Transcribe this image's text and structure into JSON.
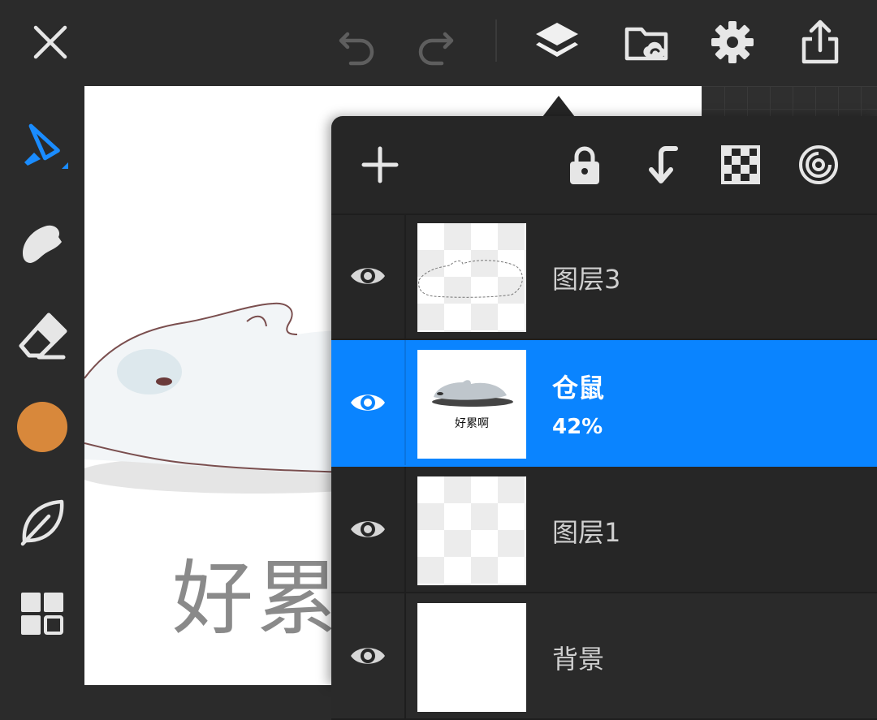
{
  "toolbar": {
    "close": "close-icon",
    "undo": "undo-icon",
    "redo": "redo-icon",
    "layers": "layers-icon",
    "gallery": "gallery-cloud-icon",
    "settings": "gear-icon",
    "share": "share-icon"
  },
  "tools": {
    "brush": "brush-icon",
    "smudge": "smudge-icon",
    "eraser": "eraser-icon",
    "color": "#d8883b",
    "leaf": "leaf-icon",
    "more": "grid-icon"
  },
  "canvas": {
    "text": "好累"
  },
  "layers_panel": {
    "toolbar": [
      "add-icon",
      "lock-icon",
      "merge-down-icon",
      "transparency-icon",
      "layer-effect-icon"
    ],
    "accent": "#0a84ff",
    "layers": [
      {
        "name": "图层3",
        "opacity": "",
        "selected": false,
        "thumb": "sketch"
      },
      {
        "name": "仓鼠",
        "opacity": "42%",
        "selected": true,
        "thumb": "hamster",
        "thumb_caption": "好累啊"
      },
      {
        "name": "图层1",
        "opacity": "",
        "selected": false,
        "thumb": "empty"
      },
      {
        "name": "背景",
        "opacity": "",
        "selected": false,
        "thumb": "white"
      }
    ]
  }
}
